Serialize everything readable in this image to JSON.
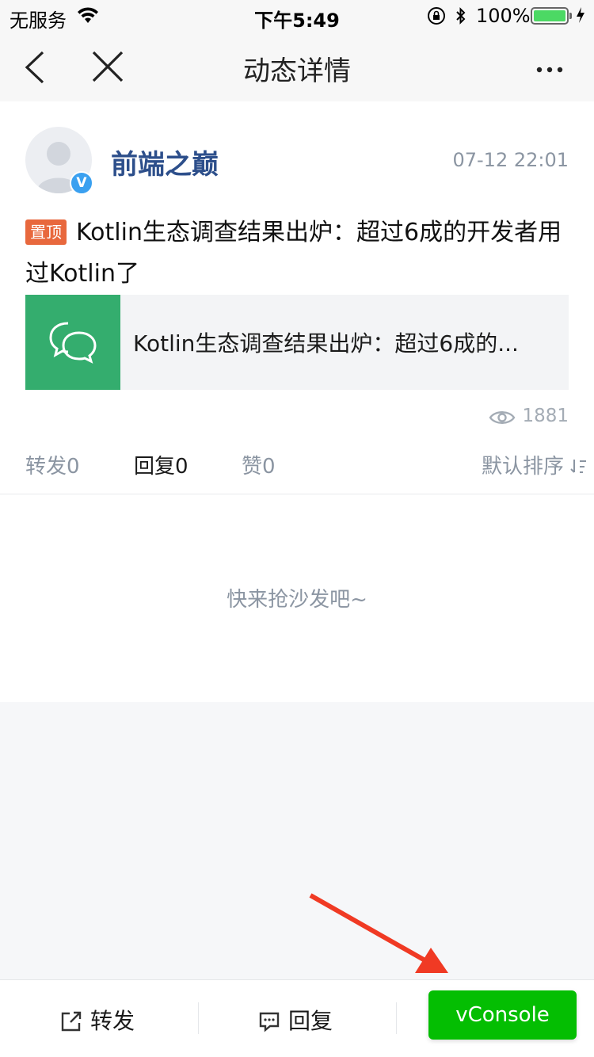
{
  "status_bar": {
    "carrier": "无服务",
    "time": "下午5:49",
    "battery": "100%",
    "battery_level": 1.0
  },
  "nav": {
    "title": "动态详情",
    "icons": [
      "back-icon",
      "close-icon",
      "more-icon"
    ]
  },
  "post": {
    "author": "前端之巅",
    "verified_badge": "V",
    "time": "07-12 22:01",
    "pin_label": "置顶",
    "text": "Kotlin生态调查结果出炉：超过6成的开发者用过Kotlin了",
    "link_title": "Kotlin生态调查结果出炉：超过6成的...",
    "views": "1881"
  },
  "tabs": [
    {
      "label": "转发0"
    },
    {
      "label": "回复0"
    },
    {
      "label": "赞0"
    }
  ],
  "sort_label": "默认排序",
  "empty_text": "快来抢沙发吧~",
  "bottom": {
    "forward": "转发",
    "reply": "回复"
  },
  "vconsole": "vConsole",
  "colors": {
    "author": "#2d4f8b",
    "pin_badge": "#e8683d",
    "thumb": "#34ad6e",
    "vconsole": "#04be02",
    "annotation_arrow": "#f03a24"
  }
}
